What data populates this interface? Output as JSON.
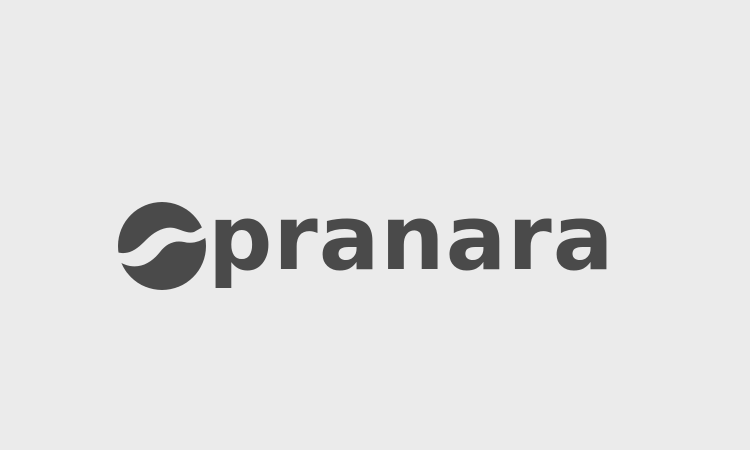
{
  "brand": {
    "name": "pranara",
    "mark_icon": "swirl-circle-icon",
    "color": "#4a4a4a",
    "background": "#ebebeb"
  }
}
